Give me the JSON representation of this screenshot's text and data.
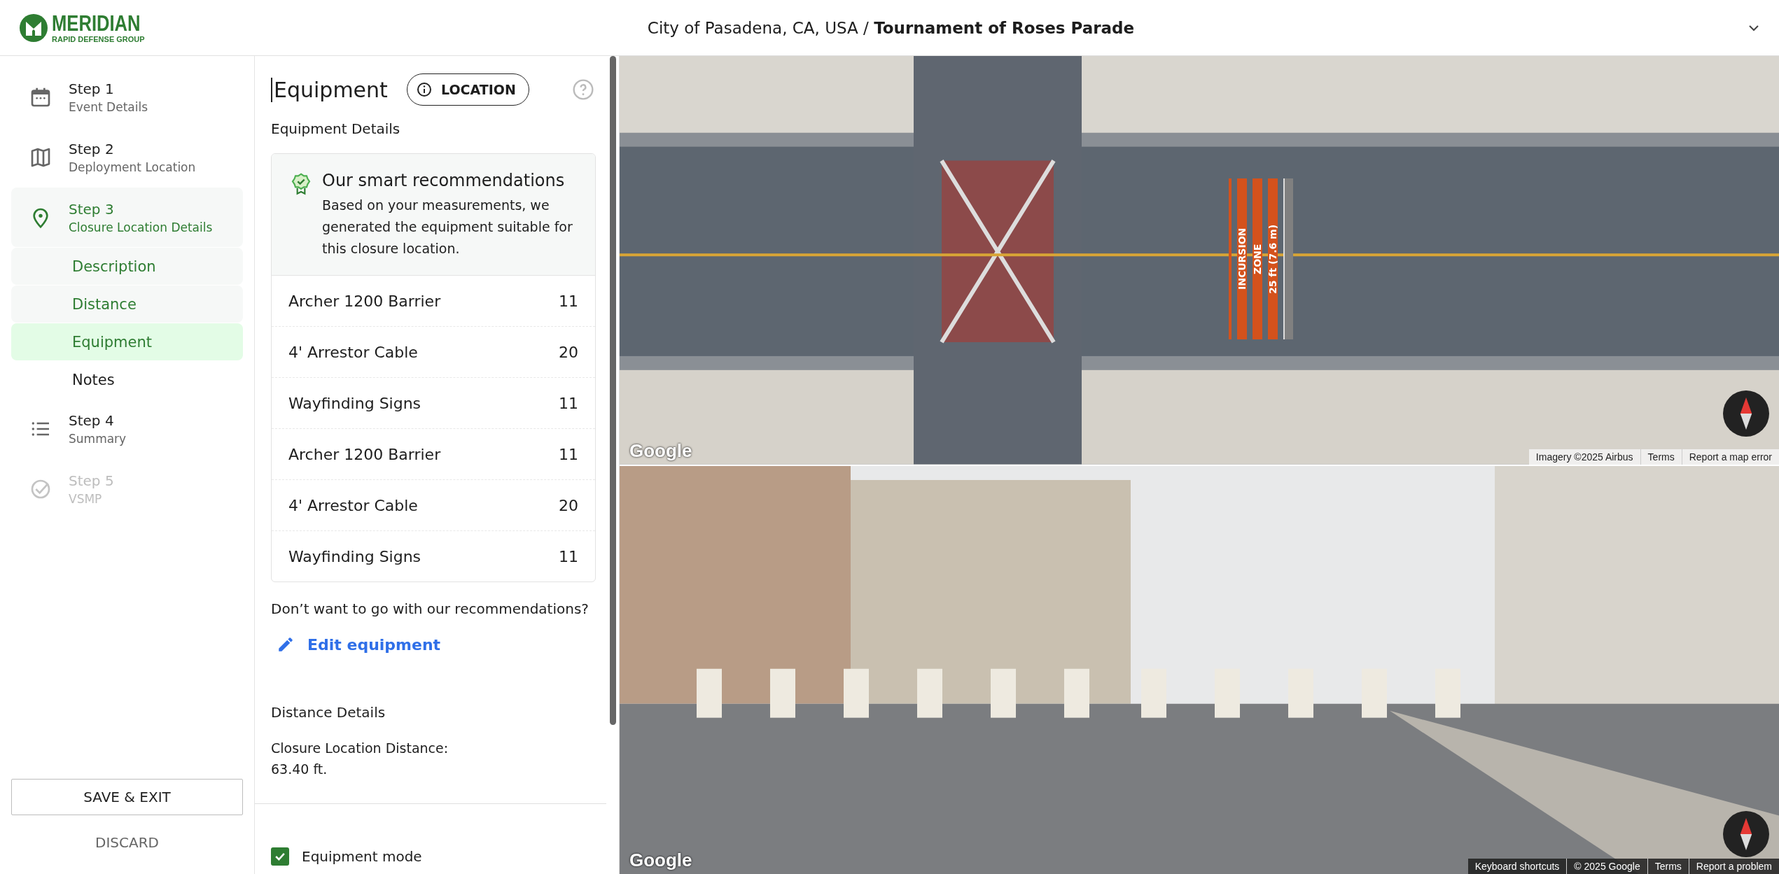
{
  "header": {
    "logo": {
      "name": "MERIDIAN",
      "tagline": "RAPID DEFENSE GROUP"
    },
    "title": "City of Pasadena, CA, USA / **Tournament of Roses Parade**"
  },
  "sidebar": {
    "steps": [
      {
        "title": "Step 1",
        "subtitle": "Event Details",
        "selected": false,
        "disabled": false
      },
      {
        "title": "Step 2",
        "subtitle": "Deployment Location",
        "selected": false,
        "disabled": false
      },
      {
        "title": "Step 3",
        "subtitle": "Closure Location Details",
        "selected": true,
        "disabled": false,
        "children": [
          {
            "label": "Description",
            "selected": false,
            "visited": true
          },
          {
            "label": "Distance",
            "selected": false,
            "visited": true
          },
          {
            "label": "Equipment",
            "selected": true,
            "visited": true
          },
          {
            "label": "Notes",
            "selected": false,
            "visited": false
          }
        ]
      },
      {
        "title": "Step 4",
        "subtitle": "Summary",
        "selected": false,
        "disabled": false
      },
      {
        "title": "Step 5",
        "subtitle": "VSMP",
        "selected": false,
        "disabled": true
      }
    ],
    "save_button": "SAVE & EXIT",
    "discard_button": "DISCARD"
  },
  "panel": {
    "title": "Equipment",
    "location_button": "LOCATION",
    "section_title": "Equipment Details",
    "recommendation": {
      "title": "Our smart recommendations",
      "text": "Based on your measurements, we generated the equipment suitable for this closure location."
    },
    "items": [
      {
        "name": "Archer 1200 Barrier",
        "quantity": "11"
      },
      {
        "name": "4' Arrestor Cable",
        "quantity": "20"
      },
      {
        "name": "Wayfinding Signs",
        "quantity": "11"
      },
      {
        "name": "Archer 1200 Barrier",
        "quantity": "11"
      },
      {
        "name": "4' Arrestor Cable",
        "quantity": "20"
      },
      {
        "name": "Wayfinding Signs",
        "quantity": "11"
      }
    ],
    "prompt": "Don’t want to go with our recommendations?",
    "edit_link": "Edit equipment",
    "distance_title": "Distance Details",
    "distance_label": "Closure Location Distance:",
    "distance_value": "63.40 ft.",
    "equipment_mode": {
      "label": "Equipment mode",
      "checked": true
    }
  },
  "map": {
    "aerial": {
      "zone_labels": [
        "INCURSION",
        "ZONE",
        "25 ft (7.6 m)"
      ],
      "logo": "Google",
      "attribution": [
        "Imagery ©2025 Airbus",
        "Terms",
        "Report a map error"
      ]
    },
    "street": {
      "logo": "Google",
      "attribution": [
        "Keyboard shortcuts",
        "© 2025 Google",
        "Terms",
        "Report a problem"
      ]
    }
  }
}
